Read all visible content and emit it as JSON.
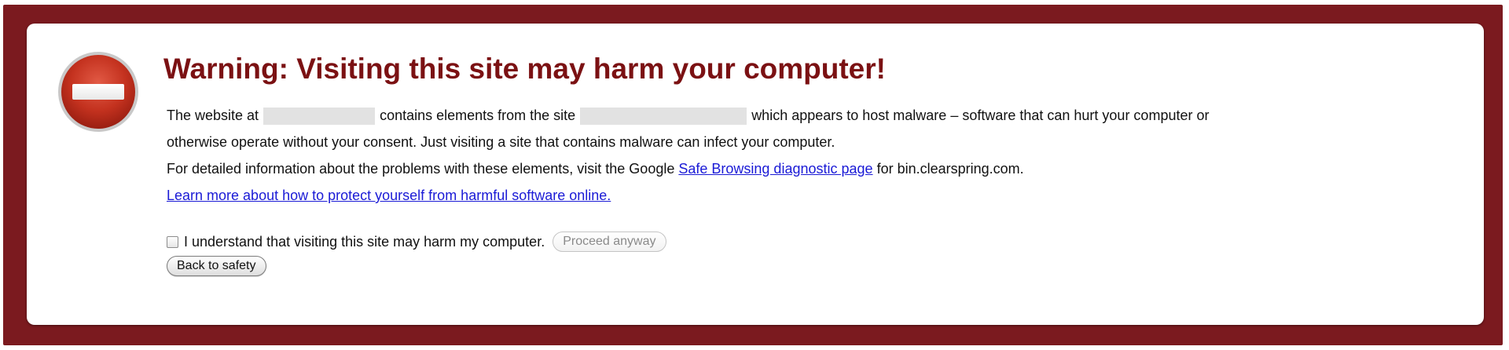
{
  "warning": {
    "title": "Warning: Visiting this site may harm your computer!",
    "icon": "stop-icon",
    "accent_color": "#7b1113",
    "frame_color": "#7b1a1f"
  },
  "message": {
    "line1_part1": "The website at",
    "line1_part2": "contains elements from the site",
    "line1_part3": "which appears to host malware – software that can hurt your computer or",
    "line2": "otherwise operate without your consent. Just visiting a site that contains malware can infect your computer.",
    "line3_part1": "For detailed information about the problems with these elements, visit the Google",
    "diagnostic_link": "Safe Browsing diagnostic page",
    "line3_part2": "for bin.clearspring.com.",
    "learn_more_link": "Learn more about how to protect yourself from harmful software online."
  },
  "actions": {
    "consent_label": "I understand that visiting this site may harm my computer.",
    "proceed_label": "Proceed anyway",
    "back_label": "Back to safety"
  }
}
